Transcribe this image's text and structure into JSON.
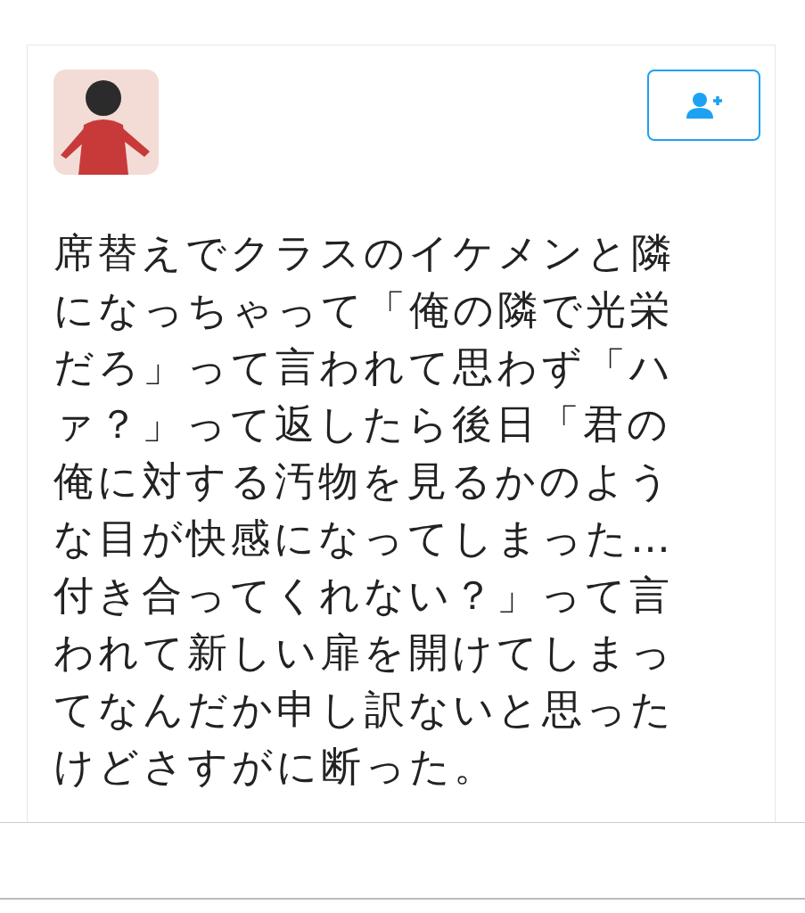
{
  "tweet": {
    "text": "席替えでクラスのイケメンと隣になっちゃって「俺の隣で光栄だろ」って言われて思わず「ハァ？」って返したら後日「君の俺に対する汚物を見るかのような目が快感になってしまった…付き合ってくれない？」って言われて新しい扉を開けてしまってなんだか申し訳ないと思ったけどさすがに断った。"
  }
}
